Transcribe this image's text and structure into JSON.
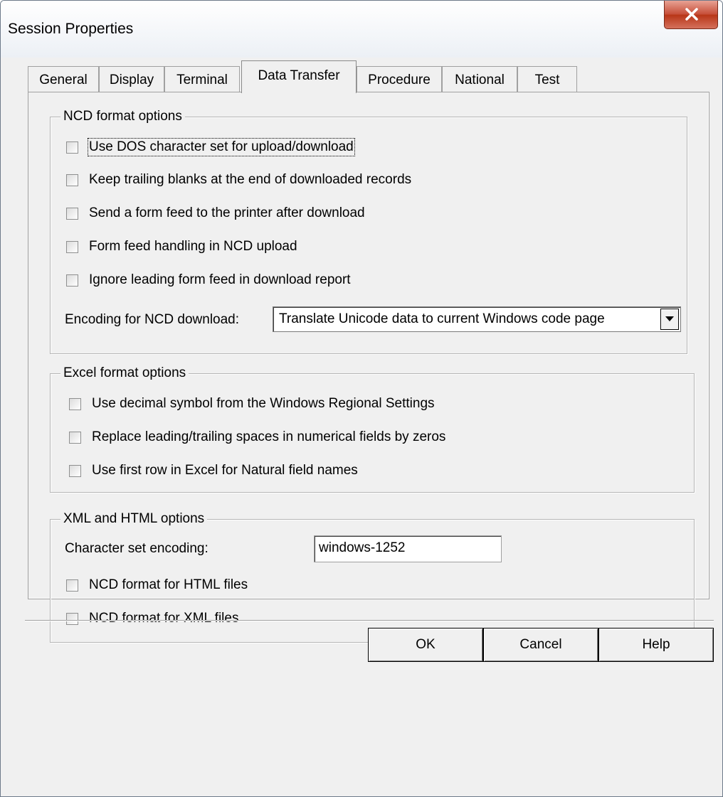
{
  "window": {
    "title": "Session Properties"
  },
  "tabs": [
    {
      "label": "General",
      "active": false
    },
    {
      "label": "Display",
      "active": false
    },
    {
      "label": "Terminal",
      "active": false
    },
    {
      "label": "Data Transfer",
      "active": true
    },
    {
      "label": "Procedure",
      "active": false
    },
    {
      "label": "National",
      "active": false
    },
    {
      "label": "Test",
      "active": false
    }
  ],
  "ncd": {
    "group_label": "NCD format options",
    "options": [
      {
        "label": "Use DOS character set for upload/download",
        "checked": false
      },
      {
        "label": "Keep trailing blanks at the end of downloaded records",
        "checked": false
      },
      {
        "label": "Send a form feed to the printer after download",
        "checked": false
      },
      {
        "label": "Form feed handling in NCD upload",
        "checked": false
      },
      {
        "label": "Ignore leading form feed in download report",
        "checked": false
      }
    ],
    "encoding_label": "Encoding for NCD download:",
    "encoding_value": "Translate Unicode data to current Windows code page"
  },
  "excel": {
    "group_label": "Excel format options",
    "options": [
      {
        "label": "Use decimal symbol from the Windows Regional Settings",
        "checked": false
      },
      {
        "label": "Replace leading/trailing spaces in numerical fields by zeros",
        "checked": false
      },
      {
        "label": "Use first row in Excel for Natural field names",
        "checked": false
      }
    ]
  },
  "xml": {
    "group_label": "XML and HTML options",
    "charset_label": "Character set encoding:",
    "charset_value": "windows-1252",
    "options": [
      {
        "label": "NCD format for HTML files",
        "checked": false
      },
      {
        "label": "NCD format for XML files",
        "checked": false
      }
    ]
  },
  "buttons": {
    "ok": "OK",
    "cancel": "Cancel",
    "help": "Help"
  }
}
